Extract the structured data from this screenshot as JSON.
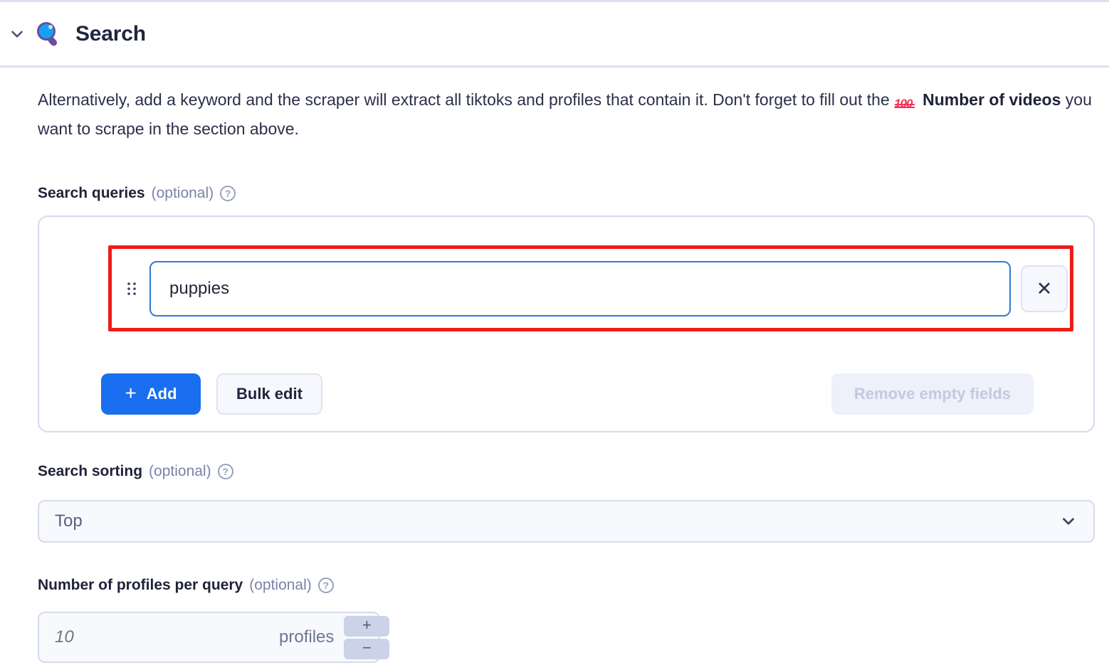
{
  "header": {
    "title": "Search",
    "icon": "magnifying-glass-emoji",
    "collapse_icon": "chevron-down-icon"
  },
  "description": {
    "part1": "Alternatively, add a keyword and the scraper will extract all tiktoks and profiles that contain it. Don't forget to fill out the ",
    "emoji": "hundred-points-emoji",
    "bold": "Number of videos",
    "part2": " you want to scrape in the section above."
  },
  "search_queries": {
    "label": "Search queries",
    "optional": "(optional)",
    "help": "?",
    "rows": [
      {
        "value": "puppies",
        "placeholder": "",
        "remove_label": "✕"
      }
    ],
    "add_label": "Add",
    "add_plus": "+",
    "bulk_edit_label": "Bulk edit",
    "remove_empty_label": "Remove empty fields",
    "highlight_color": "#ee1c18",
    "focus_border_color": "#2f79d8"
  },
  "search_sorting": {
    "label": "Search sorting",
    "optional": "(optional)",
    "help": "?",
    "selected": "Top",
    "chevron": "chevron-down-icon"
  },
  "profiles_per_query": {
    "label": "Number of profiles per query",
    "optional": "(optional)",
    "help": "?",
    "placeholder": "10",
    "value": "",
    "unit": "profiles",
    "increment_label": "+",
    "decrement_label": "−"
  },
  "colors": {
    "accent_blue": "#1a6ef0",
    "border": "#d6daeb",
    "text": "#22253f",
    "muted": "#7b83a8",
    "highlight_red": "#ee1c18"
  }
}
